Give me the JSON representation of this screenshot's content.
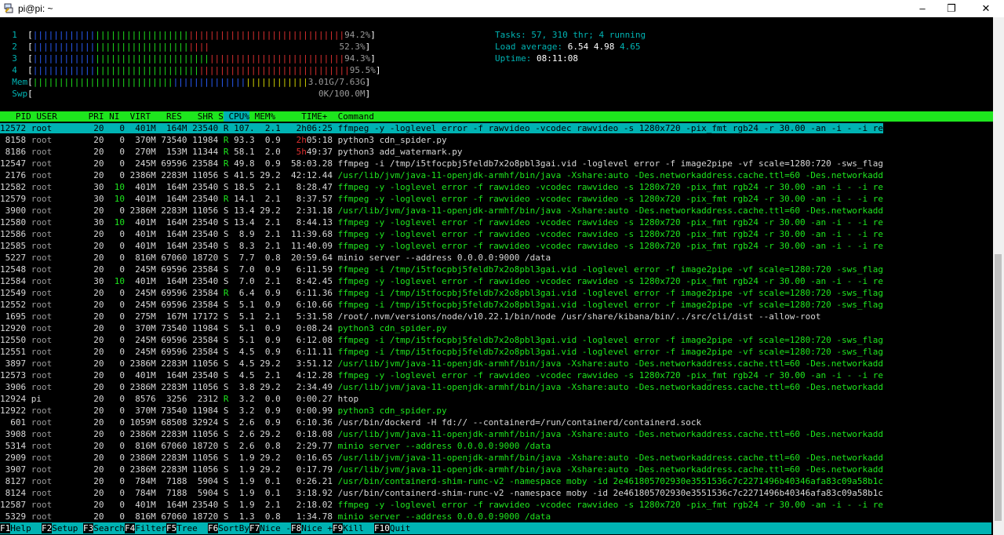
{
  "window": {
    "title": "pi@pi: ~",
    "minimize_icon": "minimize-icon",
    "maximize_icon": "restore-icon",
    "close_icon": "close-icon"
  },
  "colors": {
    "cyan": "#00b3b3",
    "green": "#1ee61e",
    "red": "#e03030",
    "blue": "#2a5fff",
    "yellow": "#d6d600",
    "background": "#000000"
  },
  "meters": {
    "cpus": [
      {
        "num": "1",
        "percent": "94.2%"
      },
      {
        "num": "2",
        "percent": "52.3%"
      },
      {
        "num": "3",
        "percent": "94.3%"
      },
      {
        "num": "4",
        "percent": "95.5%"
      }
    ],
    "mem_label": "Mem",
    "mem_value": "3.01G/7.63G",
    "swp_label": "Swp",
    "swp_value": "0K/100.0M"
  },
  "summary": {
    "tasks_label": "Tasks:",
    "tasks_value": "57,",
    "thr_value": "310",
    "thr_label": "thr;",
    "running_value": "4",
    "running_label": "running",
    "load_label": "Load average:",
    "load1": "6.54",
    "load5": "4.98",
    "load15": "4.65",
    "uptime_label": "Uptime:",
    "uptime_value": "08:11:08"
  },
  "columns": [
    "PID",
    "USER",
    "PRI",
    "NI",
    "VIRT",
    "RES",
    "SHR",
    "S",
    "CPU%",
    "MEM%",
    "TIME+",
    "Command"
  ],
  "processes": [
    {
      "pid": "12572",
      "user": "root",
      "pri": "20",
      "ni": "0",
      "virt": "401M",
      "res": "164M",
      "shr": "23540",
      "s": "R",
      "cpu": "107.",
      "mem": "2.1",
      "time": "2h06:25",
      "cmd": "ffmpeg -y -loglevel error -f rawvideo -vcodec rawvideo -s 1280x720 -pix_fmt rgb24 -r 30.00 -an -i - -i re"
    },
    {
      "pid": "8158",
      "user": "root",
      "pri": "20",
      "ni": "0",
      "virt": "370M",
      "res": "73540",
      "shr": "11984",
      "s": "R",
      "cpu": "93.3",
      "mem": "0.9",
      "time": "2h05:18",
      "cmd": "python3 cdn_spider.py"
    },
    {
      "pid": "8186",
      "user": "root",
      "pri": "20",
      "ni": "0",
      "virt": "270M",
      "res": "153M",
      "shr": "11344",
      "s": "R",
      "cpu": "58.1",
      "mem": "2.0",
      "time": "5h49:37",
      "cmd": "python3 add_watermark.py"
    },
    {
      "pid": "12547",
      "user": "root",
      "pri": "20",
      "ni": "0",
      "virt": "245M",
      "res": "69596",
      "shr": "23584",
      "s": "R",
      "cpu": "49.8",
      "mem": "0.9",
      "time": "58:03.28",
      "cmd": "ffmpeg -i /tmp/i5tfocpbj5feldb7x2o8pbl3gai.vid -loglevel error -f image2pipe -vf scale=1280:720 -sws_flag"
    },
    {
      "pid": "2176",
      "user": "root",
      "pri": "20",
      "ni": "0",
      "virt": "2386M",
      "res": "2283M",
      "shr": "11056",
      "s": "S",
      "cpu": "41.5",
      "mem": "29.2",
      "time": "42:12.44",
      "cmd": "/usr/lib/jvm/java-11-openjdk-armhf/bin/java -Xshare:auto -Des.networkaddress.cache.ttl=60 -Des.networkadd"
    },
    {
      "pid": "12582",
      "user": "root",
      "pri": "30",
      "ni": "10",
      "virt": "401M",
      "res": "164M",
      "shr": "23540",
      "s": "S",
      "cpu": "18.5",
      "mem": "2.1",
      "time": "8:28.47",
      "cmd": "ffmpeg -y -loglevel error -f rawvideo -vcodec rawvideo -s 1280x720 -pix_fmt rgb24 -r 30.00 -an -i - -i re"
    },
    {
      "pid": "12579",
      "user": "root",
      "pri": "30",
      "ni": "10",
      "virt": "401M",
      "res": "164M",
      "shr": "23540",
      "s": "R",
      "cpu": "14.1",
      "mem": "2.1",
      "time": "8:37.57",
      "cmd": "ffmpeg -y -loglevel error -f rawvideo -vcodec rawvideo -s 1280x720 -pix_fmt rgb24 -r 30.00 -an -i - -i re"
    },
    {
      "pid": "3900",
      "user": "root",
      "pri": "20",
      "ni": "0",
      "virt": "2386M",
      "res": "2283M",
      "shr": "11056",
      "s": "S",
      "cpu": "13.4",
      "mem": "29.2",
      "time": "2:31.18",
      "cmd": "/usr/lib/jvm/java-11-openjdk-armhf/bin/java -Xshare:auto -Des.networkaddress.cache.ttl=60 -Des.networkadd"
    },
    {
      "pid": "12580",
      "user": "root",
      "pri": "30",
      "ni": "10",
      "virt": "401M",
      "res": "164M",
      "shr": "23540",
      "s": "S",
      "cpu": "13.4",
      "mem": "2.1",
      "time": "8:44.13",
      "cmd": "ffmpeg -y -loglevel error -f rawvideo -vcodec rawvideo -s 1280x720 -pix_fmt rgb24 -r 30.00 -an -i - -i re"
    },
    {
      "pid": "12586",
      "user": "root",
      "pri": "20",
      "ni": "0",
      "virt": "401M",
      "res": "164M",
      "shr": "23540",
      "s": "S",
      "cpu": "8.9",
      "mem": "2.1",
      "time": "11:39.68",
      "cmd": "ffmpeg -y -loglevel error -f rawvideo -vcodec rawvideo -s 1280x720 -pix_fmt rgb24 -r 30.00 -an -i - -i re"
    },
    {
      "pid": "12585",
      "user": "root",
      "pri": "20",
      "ni": "0",
      "virt": "401M",
      "res": "164M",
      "shr": "23540",
      "s": "S",
      "cpu": "8.3",
      "mem": "2.1",
      "time": "11:40.09",
      "cmd": "ffmpeg -y -loglevel error -f rawvideo -vcodec rawvideo -s 1280x720 -pix_fmt rgb24 -r 30.00 -an -i - -i re"
    },
    {
      "pid": "5227",
      "user": "root",
      "pri": "20",
      "ni": "0",
      "virt": "816M",
      "res": "67060",
      "shr": "18720",
      "s": "S",
      "cpu": "7.7",
      "mem": "0.8",
      "time": "20:59.64",
      "cmd": "minio server --address 0.0.0.0:9000 /data"
    },
    {
      "pid": "12548",
      "user": "root",
      "pri": "20",
      "ni": "0",
      "virt": "245M",
      "res": "69596",
      "shr": "23584",
      "s": "S",
      "cpu": "7.0",
      "mem": "0.9",
      "time": "6:11.59",
      "cmd": "ffmpeg -i /tmp/i5tfocpbj5feldb7x2o8pbl3gai.vid -loglevel error -f image2pipe -vf scale=1280:720 -sws_flag"
    },
    {
      "pid": "12584",
      "user": "root",
      "pri": "30",
      "ni": "10",
      "virt": "401M",
      "res": "164M",
      "shr": "23540",
      "s": "S",
      "cpu": "7.0",
      "mem": "2.1",
      "time": "8:42.45",
      "cmd": "ffmpeg -y -loglevel error -f rawvideo -vcodec rawvideo -s 1280x720 -pix_fmt rgb24 -r 30.00 -an -i - -i re"
    },
    {
      "pid": "12549",
      "user": "root",
      "pri": "20",
      "ni": "0",
      "virt": "245M",
      "res": "69596",
      "shr": "23584",
      "s": "R",
      "cpu": "6.4",
      "mem": "0.9",
      "time": "6:11.36",
      "cmd": "ffmpeg -i /tmp/i5tfocpbj5feldb7x2o8pbl3gai.vid -loglevel error -f image2pipe -vf scale=1280:720 -sws_flag"
    },
    {
      "pid": "12552",
      "user": "root",
      "pri": "20",
      "ni": "0",
      "virt": "245M",
      "res": "69596",
      "shr": "23584",
      "s": "S",
      "cpu": "5.1",
      "mem": "0.9",
      "time": "6:10.66",
      "cmd": "ffmpeg -i /tmp/i5tfocpbj5feldb7x2o8pbl3gai.vid -loglevel error -f image2pipe -vf scale=1280:720 -sws_flag"
    },
    {
      "pid": "1695",
      "user": "root",
      "pri": "20",
      "ni": "0",
      "virt": "275M",
      "res": "167M",
      "shr": "17172",
      "s": "S",
      "cpu": "5.1",
      "mem": "2.1",
      "time": "5:31.58",
      "cmd": "/root/.nvm/versions/node/v10.22.1/bin/node /usr/share/kibana/bin/../src/cli/dist --allow-root"
    },
    {
      "pid": "12920",
      "user": "root",
      "pri": "20",
      "ni": "0",
      "virt": "370M",
      "res": "73540",
      "shr": "11984",
      "s": "S",
      "cpu": "5.1",
      "mem": "0.9",
      "time": "0:08.24",
      "cmd": "python3 cdn_spider.py"
    },
    {
      "pid": "12550",
      "user": "root",
      "pri": "20",
      "ni": "0",
      "virt": "245M",
      "res": "69596",
      "shr": "23584",
      "s": "S",
      "cpu": "5.1",
      "mem": "0.9",
      "time": "6:12.08",
      "cmd": "ffmpeg -i /tmp/i5tfocpbj5feldb7x2o8pbl3gai.vid -loglevel error -f image2pipe -vf scale=1280:720 -sws_flag"
    },
    {
      "pid": "12551",
      "user": "root",
      "pri": "20",
      "ni": "0",
      "virt": "245M",
      "res": "69596",
      "shr": "23584",
      "s": "S",
      "cpu": "4.5",
      "mem": "0.9",
      "time": "6:11.11",
      "cmd": "ffmpeg -i /tmp/i5tfocpbj5feldb7x2o8pbl3gai.vid -loglevel error -f image2pipe -vf scale=1280:720 -sws_flag"
    },
    {
      "pid": "3897",
      "user": "root",
      "pri": "20",
      "ni": "0",
      "virt": "2386M",
      "res": "2283M",
      "shr": "11056",
      "s": "S",
      "cpu": "4.5",
      "mem": "29.2",
      "time": "3:51.12",
      "cmd": "/usr/lib/jvm/java-11-openjdk-armhf/bin/java -Xshare:auto -Des.networkaddress.cache.ttl=60 -Des.networkadd"
    },
    {
      "pid": "12573",
      "user": "root",
      "pri": "20",
      "ni": "0",
      "virt": "401M",
      "res": "164M",
      "shr": "23540",
      "s": "S",
      "cpu": "4.5",
      "mem": "2.1",
      "time": "4:12.28",
      "cmd": "ffmpeg -y -loglevel error -f rawvideo -vcodec rawvideo -s 1280x720 -pix_fmt rgb24 -r 30.00 -an -i - -i re"
    },
    {
      "pid": "3906",
      "user": "root",
      "pri": "20",
      "ni": "0",
      "virt": "2386M",
      "res": "2283M",
      "shr": "11056",
      "s": "S",
      "cpu": "3.8",
      "mem": "29.2",
      "time": "2:34.49",
      "cmd": "/usr/lib/jvm/java-11-openjdk-armhf/bin/java -Xshare:auto -Des.networkaddress.cache.ttl=60 -Des.networkadd"
    },
    {
      "pid": "12924",
      "user": "pi",
      "pri": "20",
      "ni": "0",
      "virt": "8576",
      "res": "3256",
      "shr": "2312",
      "s": "R",
      "cpu": "3.2",
      "mem": "0.0",
      "time": "0:00.27",
      "cmd": "htop"
    },
    {
      "pid": "12922",
      "user": "root",
      "pri": "20",
      "ni": "0",
      "virt": "370M",
      "res": "73540",
      "shr": "11984",
      "s": "S",
      "cpu": "3.2",
      "mem": "0.9",
      "time": "0:00.99",
      "cmd": "python3 cdn_spider.py"
    },
    {
      "pid": "601",
      "user": "root",
      "pri": "20",
      "ni": "0",
      "virt": "1059M",
      "res": "68508",
      "shr": "32924",
      "s": "S",
      "cpu": "2.6",
      "mem": "0.9",
      "time": "6:10.36",
      "cmd": "/usr/bin/dockerd -H fd:// --containerd=/run/containerd/containerd.sock"
    },
    {
      "pid": "3908",
      "user": "root",
      "pri": "20",
      "ni": "0",
      "virt": "2386M",
      "res": "2283M",
      "shr": "11056",
      "s": "S",
      "cpu": "2.6",
      "mem": "29.2",
      "time": "0:18.08",
      "cmd": "/usr/lib/jvm/java-11-openjdk-armhf/bin/java -Xshare:auto -Des.networkaddress.cache.ttl=60 -Des.networkadd"
    },
    {
      "pid": "5314",
      "user": "root",
      "pri": "20",
      "ni": "0",
      "virt": "816M",
      "res": "67060",
      "shr": "18720",
      "s": "S",
      "cpu": "2.6",
      "mem": "0.8",
      "time": "2:29.77",
      "cmd": "minio server --address 0.0.0.0:9000 /data"
    },
    {
      "pid": "2909",
      "user": "root",
      "pri": "20",
      "ni": "0",
      "virt": "2386M",
      "res": "2283M",
      "shr": "11056",
      "s": "S",
      "cpu": "1.9",
      "mem": "29.2",
      "time": "0:16.65",
      "cmd": "/usr/lib/jvm/java-11-openjdk-armhf/bin/java -Xshare:auto -Des.networkaddress.cache.ttl=60 -Des.networkadd"
    },
    {
      "pid": "3907",
      "user": "root",
      "pri": "20",
      "ni": "0",
      "virt": "2386M",
      "res": "2283M",
      "shr": "11056",
      "s": "S",
      "cpu": "1.9",
      "mem": "29.2",
      "time": "0:17.79",
      "cmd": "/usr/lib/jvm/java-11-openjdk-armhf/bin/java -Xshare:auto -Des.networkaddress.cache.ttl=60 -Des.networkadd"
    },
    {
      "pid": "8127",
      "user": "root",
      "pri": "20",
      "ni": "0",
      "virt": "784M",
      "res": "7188",
      "shr": "5904",
      "s": "S",
      "cpu": "1.9",
      "mem": "0.1",
      "time": "0:26.21",
      "cmd": "/usr/bin/containerd-shim-runc-v2 -namespace moby -id 2e461805702930e3551536c7c2271496b40346afa83c09a58b1c"
    },
    {
      "pid": "8124",
      "user": "root",
      "pri": "20",
      "ni": "0",
      "virt": "784M",
      "res": "7188",
      "shr": "5904",
      "s": "S",
      "cpu": "1.9",
      "mem": "0.1",
      "time": "3:18.92",
      "cmd": "/usr/bin/containerd-shim-runc-v2 -namespace moby -id 2e461805702930e3551536c7c2271496b40346afa83c09a58b1c"
    },
    {
      "pid": "12587",
      "user": "root",
      "pri": "20",
      "ni": "0",
      "virt": "401M",
      "res": "164M",
      "shr": "23540",
      "s": "S",
      "cpu": "1.9",
      "mem": "2.1",
      "time": "2:18.02",
      "cmd": "ffmpeg -y -loglevel error -f rawvideo -vcodec rawvideo -s 1280x720 -pix_fmt rgb24 -r 30.00 -an -i - -i re"
    },
    {
      "pid": "5329",
      "user": "root",
      "pri": "20",
      "ni": "0",
      "virt": "816M",
      "res": "67060",
      "shr": "18720",
      "s": "S",
      "cpu": "1.3",
      "mem": "0.8",
      "time": "1:34.78",
      "cmd": "minio server --address 0.0.0.0:9000 /data"
    }
  ],
  "function_keys": [
    {
      "key": "F1",
      "label": "Help  "
    },
    {
      "key": "F2",
      "label": "Setup "
    },
    {
      "key": "F3",
      "label": "Search"
    },
    {
      "key": "F4",
      "label": "Filter"
    },
    {
      "key": "F5",
      "label": "Tree  "
    },
    {
      "key": "F6",
      "label": "SortBy"
    },
    {
      "key": "F7",
      "label": "Nice -"
    },
    {
      "key": "F8",
      "label": "Nice +"
    },
    {
      "key": "F9",
      "label": "Kill  "
    },
    {
      "key": "F10",
      "label": "Quit"
    }
  ]
}
